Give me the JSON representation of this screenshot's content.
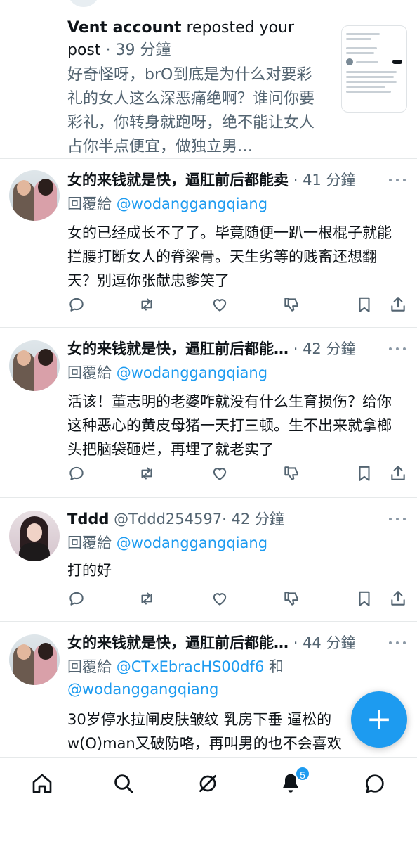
{
  "repost": {
    "user": "Vent account",
    "action": "reposted your post",
    "separator": "·",
    "time": "39 分鐘",
    "text": "好奇怪呀，brO到底是为什么对要彩礼的女人这么深恶痛绝啊？谁问你要彩礼，你转身就跑呀，绝不能让女人占你半点便宜，做独立男…"
  },
  "tweets": [
    {
      "name": "女的来钱就是快，逼肛前后都能卖",
      "handle": "",
      "separator": "·",
      "time": "41 分鐘",
      "reply_prefix": "回覆給",
      "reply_to": "@wodanggangqiang",
      "reply_to_2": "",
      "reply_and": "",
      "text": "女的已经成长不了了。毕竟随便一趴一根棍子就能拦腰打断女人的脊梁骨。天生劣等的贱畜还想翻天？别逗你张献忠爹笑了",
      "avatar": "couple-avatar"
    },
    {
      "name": "女的来钱就是快，逼肛前后都能…",
      "handle": "",
      "separator": "·",
      "time": "42 分鐘",
      "reply_prefix": "回覆給",
      "reply_to": "@wodanggangqiang",
      "reply_to_2": "",
      "reply_and": "",
      "text": "活该！董志明的老婆咋就没有什么生育损伤？给你这种恶心的黄皮母猪一天打三顿。生不出来就拿榔头把脑袋砸烂，再埋了就老实了",
      "avatar": "couple-avatar"
    },
    {
      "name": "Tddd",
      "handle": "@Tddd254597",
      "separator": "·",
      "time": "42 分鐘",
      "reply_prefix": "回覆給",
      "reply_to": "@wodanggangqiang",
      "reply_to_2": "",
      "reply_and": "",
      "text": "打的好",
      "avatar": "girl-avatar"
    },
    {
      "name": "女的来钱就是快，逼肛前后都能…",
      "handle": "",
      "separator": "·",
      "time": "44 分鐘",
      "reply_prefix": "回覆給",
      "reply_to": "@CTxEbracHS00df6",
      "reply_and": "和",
      "reply_to_2": "@wodanggangqiang",
      "text": "30岁停水拉闸皮肤皱纹 乳房下垂 逼松的 w(O)man又破防咯，再叫男的也不会喜欢",
      "avatar": "couple-avatar"
    }
  ],
  "action_icons": [
    "reply-icon",
    "repost-icon",
    "like-icon",
    "dislike-icon",
    "bookmark-icon",
    "share-icon"
  ],
  "fab": {
    "label": "+"
  },
  "bottom_nav": {
    "items": [
      "home-icon",
      "search-icon",
      "grok-icon",
      "notifications-icon",
      "messages-icon"
    ],
    "notification_count": "5"
  },
  "colors": {
    "accent": "#1d9bf0",
    "text": "#0f1419",
    "muted": "#536471"
  }
}
